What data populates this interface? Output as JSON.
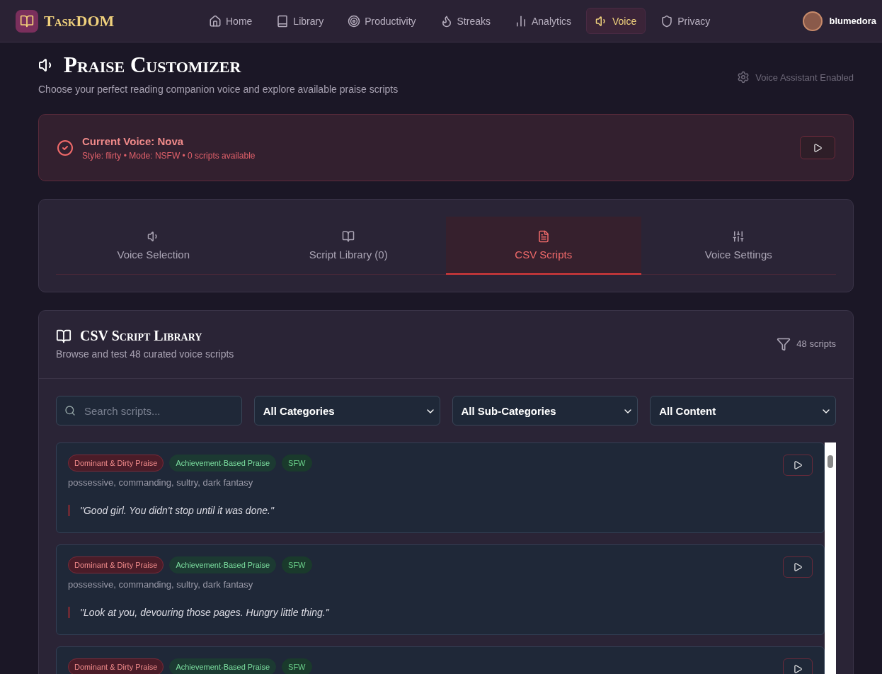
{
  "nav": {
    "brand": "TaskDOM",
    "items": [
      {
        "label": "Home",
        "selected": false
      },
      {
        "label": "Library",
        "selected": false
      },
      {
        "label": "Productivity",
        "selected": false
      },
      {
        "label": "Streaks",
        "selected": false
      },
      {
        "label": "Analytics",
        "selected": false
      },
      {
        "label": "Voice",
        "selected": true
      },
      {
        "label": "Privacy",
        "selected": false
      }
    ],
    "user": "blumedora"
  },
  "header": {
    "title": "Praise Customizer",
    "subtitle": "Choose your perfect reading companion voice and explore available praise scripts",
    "status": "Voice Assistant Enabled"
  },
  "current_voice": {
    "title": "Current Voice: Nova",
    "details": "Style: flirty • Mode: NSFW • 0 scripts available"
  },
  "tabs": [
    {
      "label": "Voice Selection",
      "selected": false
    },
    {
      "label": "Script Library (0)",
      "selected": false
    },
    {
      "label": "CSV Scripts",
      "selected": true
    },
    {
      "label": "Voice Settings",
      "selected": false
    }
  ],
  "library": {
    "title": "CSV Script Library",
    "subtitle": "Browse and test 48 curated voice scripts",
    "count": "48 scripts",
    "search": {
      "placeholder": "Search scripts..."
    },
    "filters": [
      "All Categories",
      "All Sub-Categories",
      "All Content"
    ],
    "scripts": [
      {
        "tags": [
          {
            "kind": "category",
            "label": "Dominant & Dirty Praise"
          },
          {
            "kind": "subcategory",
            "label": "Achievement-Based Praise"
          },
          {
            "kind": "rating",
            "label": "SFW"
          }
        ],
        "tone": "possessive, commanding, sultry, dark fantasy",
        "quote": "\"Good girl. You didn't stop until it was done.\""
      },
      {
        "tags": [
          {
            "kind": "category",
            "label": "Dominant & Dirty Praise"
          },
          {
            "kind": "subcategory",
            "label": "Achievement-Based Praise"
          },
          {
            "kind": "rating",
            "label": "SFW"
          }
        ],
        "tone": "possessive, commanding, sultry, dark fantasy",
        "quote": "\"Look at you, devouring those pages. Hungry little thing.\""
      },
      {
        "tags": [
          {
            "kind": "category",
            "label": "Dominant & Dirty Praise"
          },
          {
            "kind": "subcategory",
            "label": "Achievement-Based Praise"
          },
          {
            "kind": "rating",
            "label": "SFW"
          }
        ]
      }
    ]
  }
}
